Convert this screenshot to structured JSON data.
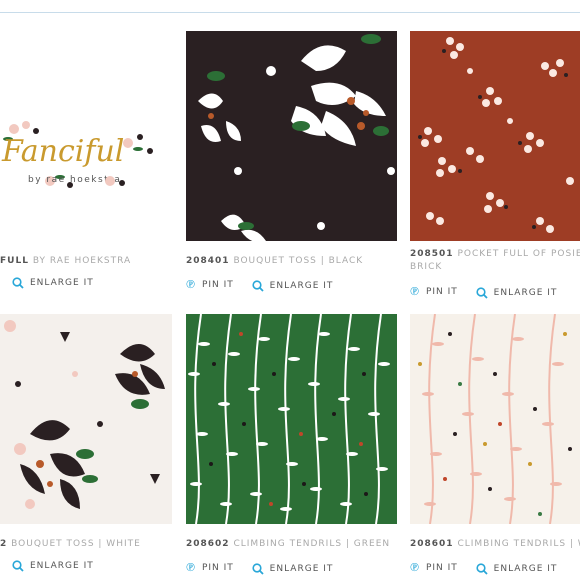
{
  "collection": {
    "logo_text": "Fanciful",
    "byline": "by rae hoekstra",
    "sku": "FULL",
    "name": "BY RAE HOEKSTRA"
  },
  "actions": {
    "pin_label": "PIN IT",
    "enlarge_label": "ENLARGE IT"
  },
  "products": [
    {
      "sku": "208401",
      "name": "BOUQUET TOSS | BLACK",
      "color": "#2a2022"
    },
    {
      "sku": "208501",
      "name": "POCKET FULL OF POSIES",
      "name2": "BRICK",
      "color": "#9e3d25"
    },
    {
      "sku": "2",
      "name": "BOUQUET TOSS | WHITE",
      "color": "#f4f0ec"
    },
    {
      "sku": "208602",
      "name": "CLIMBING TENDRILS | GREEN",
      "color": "#2c6f36"
    },
    {
      "sku": "208601",
      "name": "CLIMBING TENDRILS | WH",
      "color": "#f6f1ea"
    }
  ],
  "colors": {
    "accent": "#29a7d8",
    "sku_text": "#555555",
    "name_text": "#a9a9a9",
    "border": "#c8dcea"
  }
}
